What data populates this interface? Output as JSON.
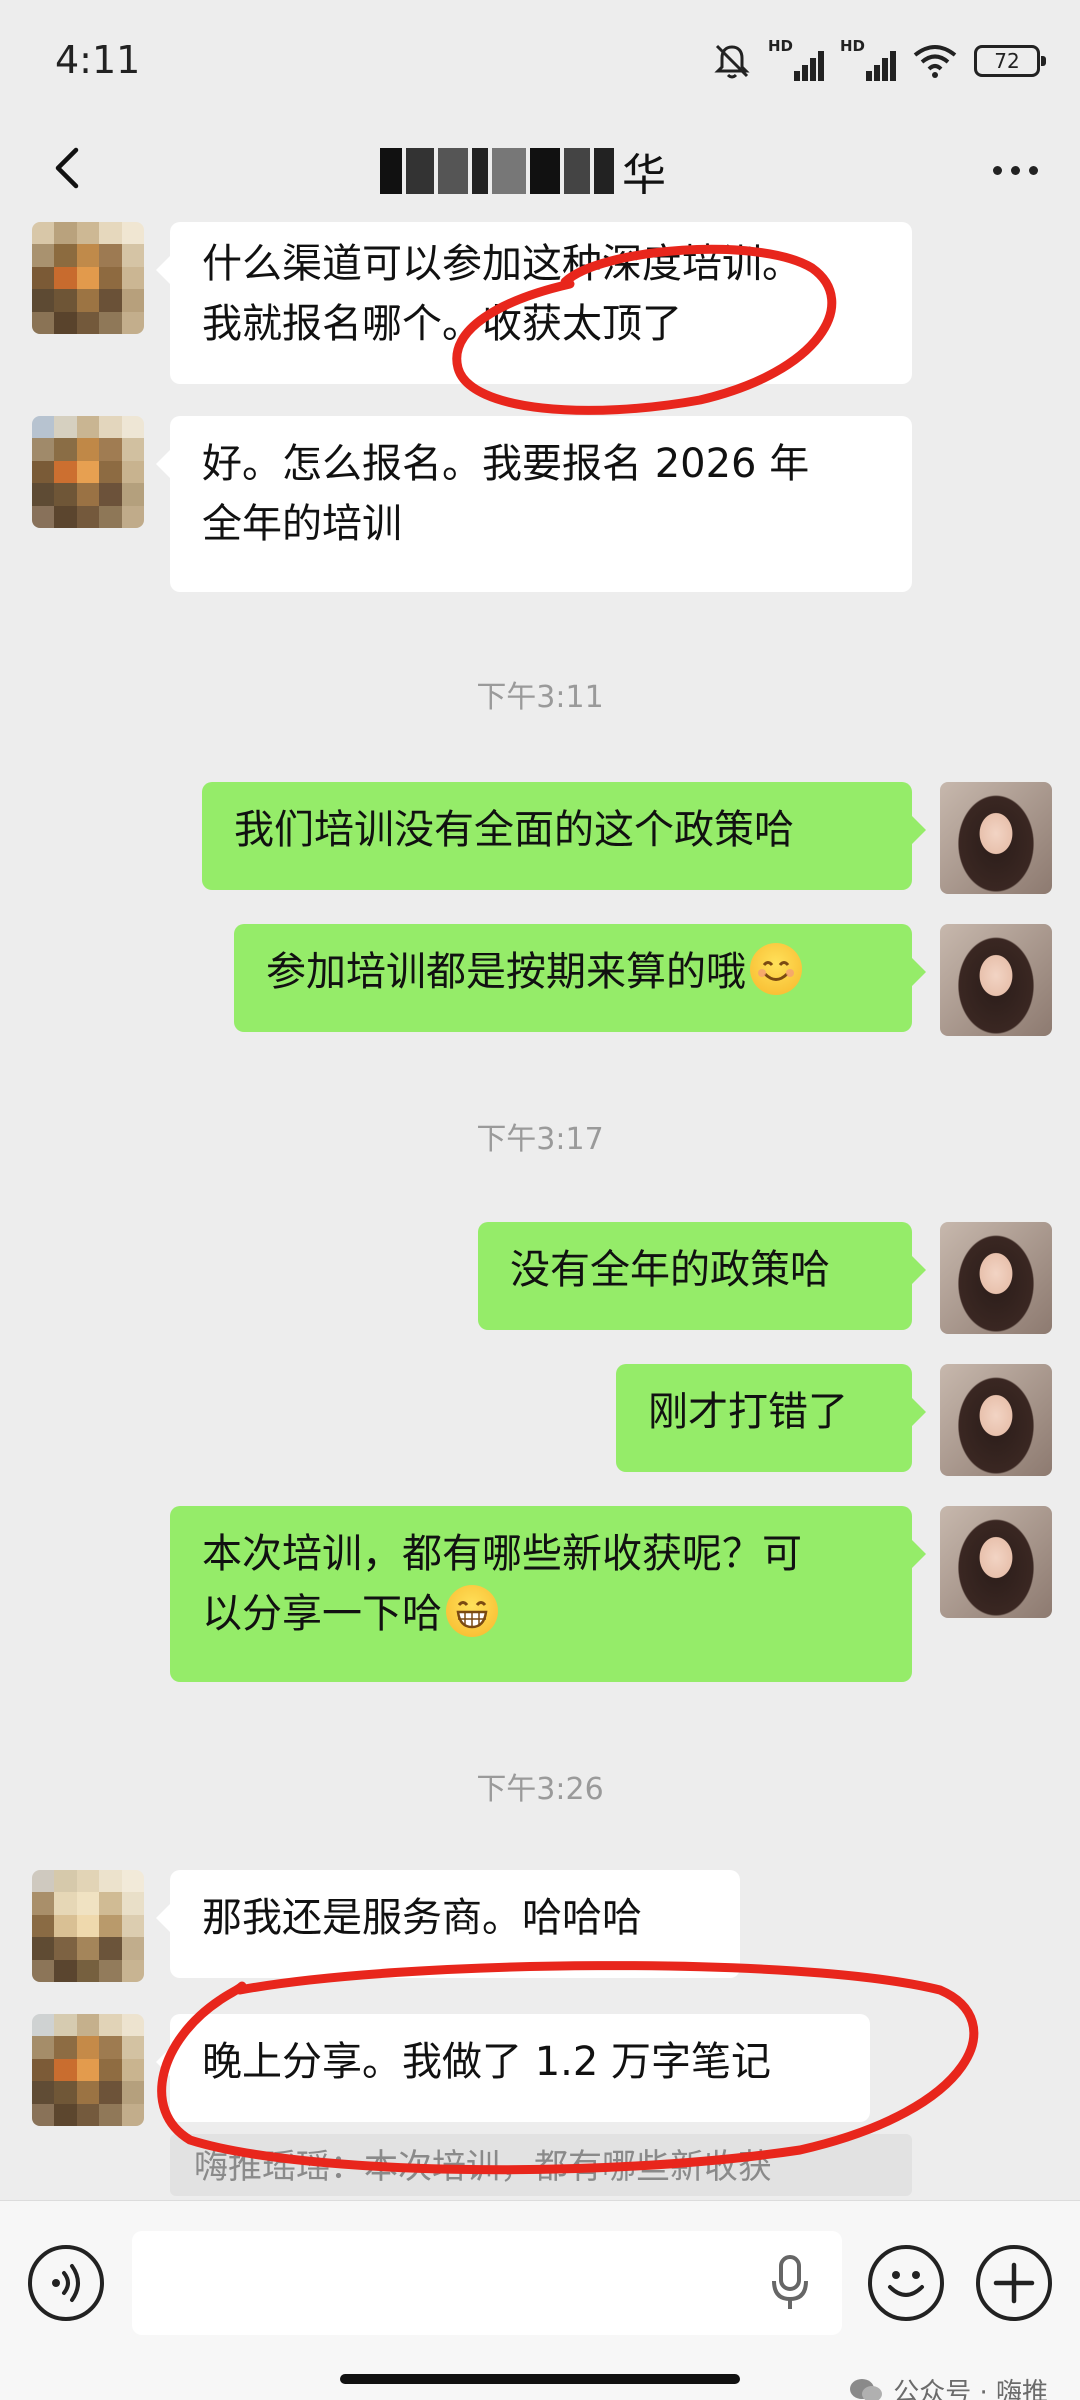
{
  "status_bar": {
    "time": "4:11",
    "signal_labels": [
      "HD",
      "HD"
    ],
    "battery": "72",
    "icons": [
      "mute-bell-icon",
      "signal-icon",
      "signal-icon",
      "wifi-icon",
      "battery-icon"
    ]
  },
  "header": {
    "title_suffix": "华",
    "back_icon": "chevron-left-icon",
    "more_icon": "more-dots-icon"
  },
  "messages": [
    {
      "side": "left",
      "text_lines": [
        "什么渠道可以参加这种深度培训。",
        "我就报名哪个。收获太顶了"
      ]
    },
    {
      "side": "left",
      "text_lines": [
        "好。怎么报名。我要报名 2026 年",
        "全年的培训"
      ]
    },
    {
      "side": "right",
      "text_lines": [
        "我们培训没有全面的这个政策哈"
      ]
    },
    {
      "side": "right",
      "text_lines": [
        "参加培训都是按期来算的哦"
      ],
      "emoji": "smile-emoji"
    },
    {
      "side": "right",
      "text_lines": [
        "没有全年的政策哈"
      ]
    },
    {
      "side": "right",
      "text_lines": [
        "刚才打错了"
      ]
    },
    {
      "side": "right",
      "text_lines": [
        "本次培训，都有哪些新收获呢？可",
        "以分享一下哈"
      ],
      "emoji": "grin-emoji"
    },
    {
      "side": "left",
      "text_lines": [
        "那我还是服务商。哈哈哈"
      ]
    },
    {
      "side": "left",
      "text_lines": [
        "晚上分享。我做了 1.2 万字笔记"
      ]
    }
  ],
  "timestamps": [
    "下午3:11",
    "下午3:17",
    "下午3:26"
  ],
  "quote": "嗨推瑶瑶：本次培训，都有哪些新收获",
  "annotation_color": "#e8261c",
  "input_bar": {
    "icons": [
      "voice-icon",
      "microphone-icon",
      "emoji-icon",
      "plus-icon"
    ]
  },
  "watermark": "公众号 · 嗨推",
  "colors": {
    "background": "#ededed",
    "bubble_self": "#95ec69",
    "bubble_other": "#ffffff",
    "timestamp": "#9a9a9a"
  }
}
